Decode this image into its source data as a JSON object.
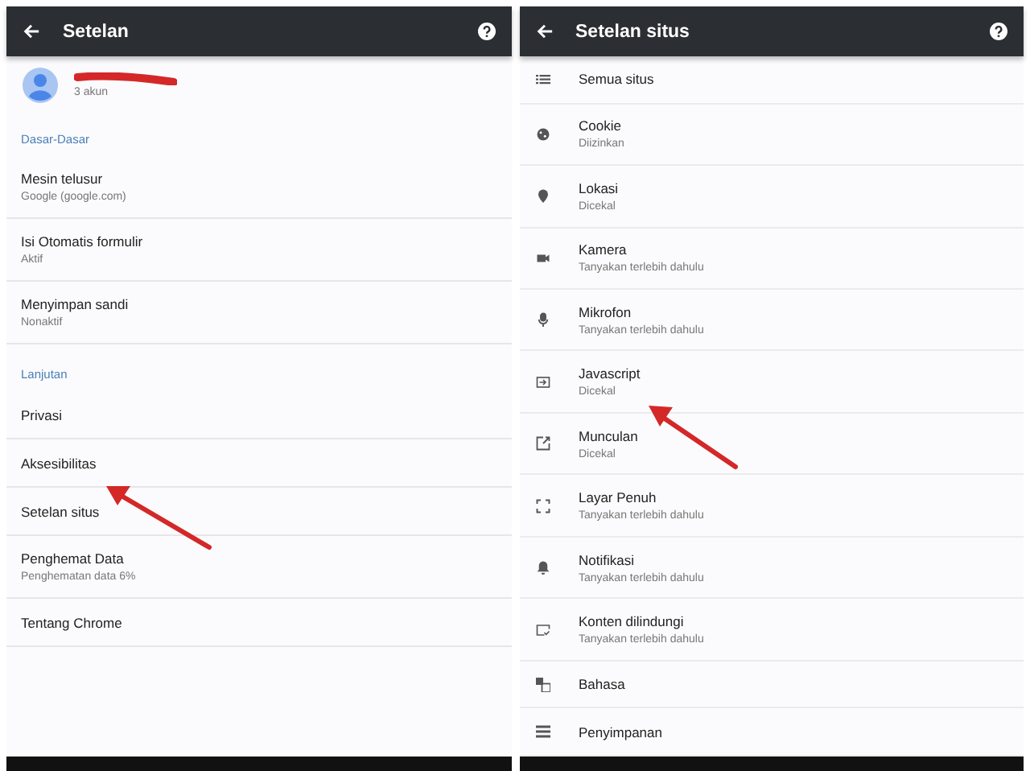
{
  "left_screen": {
    "title": "Setelan",
    "account": {
      "subtitle": "3 akun"
    },
    "sections": [
      {
        "header": "Dasar-Dasar",
        "items": [
          {
            "label": "Mesin telusur",
            "detail": "Google (google.com)"
          },
          {
            "label": "Isi Otomatis formulir",
            "detail": "Aktif"
          },
          {
            "label": "Menyimpan sandi",
            "detail": "Nonaktif"
          }
        ]
      },
      {
        "header": "Lanjutan",
        "items": [
          {
            "label": "Privasi"
          },
          {
            "label": "Aksesibilitas"
          },
          {
            "label": "Setelan situs"
          },
          {
            "label": "Penghemat Data",
            "detail": "Penghematan data 6%"
          },
          {
            "label": "Tentang Chrome"
          }
        ]
      }
    ]
  },
  "right_screen": {
    "title": "Setelan situs",
    "items": [
      {
        "label": "Semua situs"
      },
      {
        "label": "Cookie",
        "detail": "Diizinkan"
      },
      {
        "label": "Lokasi",
        "detail": "Dicekal"
      },
      {
        "label": "Kamera",
        "detail": "Tanyakan terlebih dahulu"
      },
      {
        "label": "Mikrofon",
        "detail": "Tanyakan terlebih dahulu"
      },
      {
        "label": "Javascript",
        "detail": "Dicekal"
      },
      {
        "label": "Munculan",
        "detail": "Dicekal"
      },
      {
        "label": "Layar Penuh",
        "detail": "Tanyakan terlebih dahulu"
      },
      {
        "label": "Notifikasi",
        "detail": "Tanyakan terlebih dahulu"
      },
      {
        "label": "Konten dilindungi",
        "detail": "Tanyakan terlebih dahulu"
      },
      {
        "label": "Bahasa"
      },
      {
        "label": "Penyimpanan"
      }
    ]
  }
}
